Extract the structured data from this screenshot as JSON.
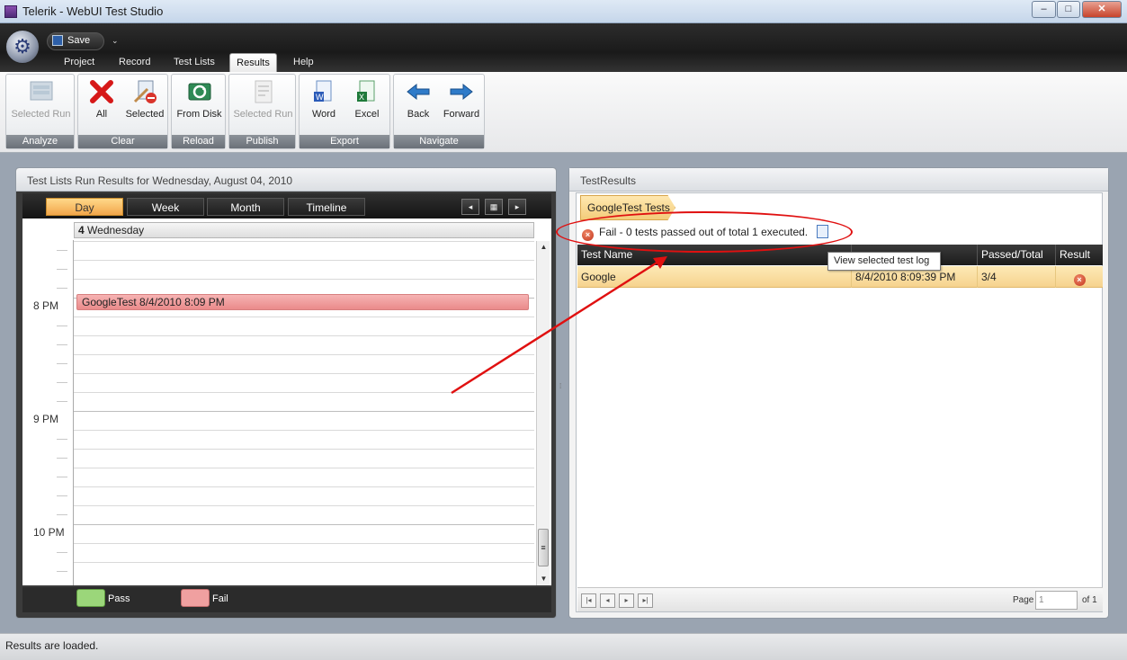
{
  "window": {
    "title": "Telerik - WebUI Test Studio",
    "minimize": "–",
    "maximize": "□",
    "close": "✕"
  },
  "qat": {
    "save_label": "Save",
    "dropdown": "⌄"
  },
  "ribbon": {
    "tabs": [
      "Project",
      "Record",
      "Test Lists",
      "Results",
      "Help"
    ],
    "active_tab": "Results",
    "groups": [
      {
        "label": "Analyze",
        "buttons": [
          {
            "label": "Selected Run",
            "icon": "selected-run-icon",
            "enabled": false
          }
        ]
      },
      {
        "label": "Clear",
        "buttons": [
          {
            "label": "All",
            "icon": "red-x-icon",
            "enabled": true
          },
          {
            "label": "Selected",
            "icon": "clear-selected-icon",
            "enabled": true
          }
        ]
      },
      {
        "label": "Reload",
        "buttons": [
          {
            "label": "From Disk",
            "icon": "reload-disk-icon",
            "enabled": true
          }
        ]
      },
      {
        "label": "Publish",
        "buttons": [
          {
            "label": "Selected Run",
            "icon": "publish-icon",
            "enabled": false
          }
        ]
      },
      {
        "label": "Export",
        "buttons": [
          {
            "label": "Word",
            "icon": "word-icon",
            "enabled": true
          },
          {
            "label": "Excel",
            "icon": "excel-icon",
            "enabled": true
          }
        ]
      },
      {
        "label": "Navigate",
        "buttons": [
          {
            "label": "Back",
            "icon": "back-arrow-icon",
            "enabled": true
          },
          {
            "label": "Forward",
            "icon": "forward-arrow-icon",
            "enabled": true
          }
        ]
      }
    ]
  },
  "calendar": {
    "title": "Test Lists Run Results for Wednesday, August 04, 2010",
    "views": [
      "Day",
      "Week",
      "Month",
      "Timeline"
    ],
    "active_view": "Day",
    "nav": {
      "prev": "◂",
      "today": "▦",
      "next": "▸"
    },
    "day_header_num": "4",
    "day_header_name": "Wednesday",
    "times": [
      "8 PM",
      "9 PM",
      "10 PM"
    ],
    "appointment": "GoogleTest 8/4/2010 8:09 PM",
    "legend": [
      {
        "label": "Pass",
        "color": "#9bd67a"
      },
      {
        "label": "Fail",
        "color": "#f0a0a0"
      }
    ]
  },
  "results": {
    "title": "TestResults",
    "crumb": "GoogleTest Tests",
    "summary": "Fail - 0 tests passed out of total 1 executed.",
    "columns": [
      "Test Name",
      "",
      "Passed/Total",
      "Result"
    ],
    "rows": [
      {
        "name": "Google",
        "time": "8/4/2010 8:09:39 PM",
        "passed_total": "3/4",
        "result": "fail"
      }
    ],
    "tooltip": "View selected test log",
    "pager": {
      "page_label": "Page",
      "page_value": "1",
      "of_label": "of 1"
    }
  },
  "status": "Results are loaded.",
  "colors": {
    "fail": "#c2321b",
    "selected_row": "#f6d38e",
    "annotation": "#e01010"
  }
}
